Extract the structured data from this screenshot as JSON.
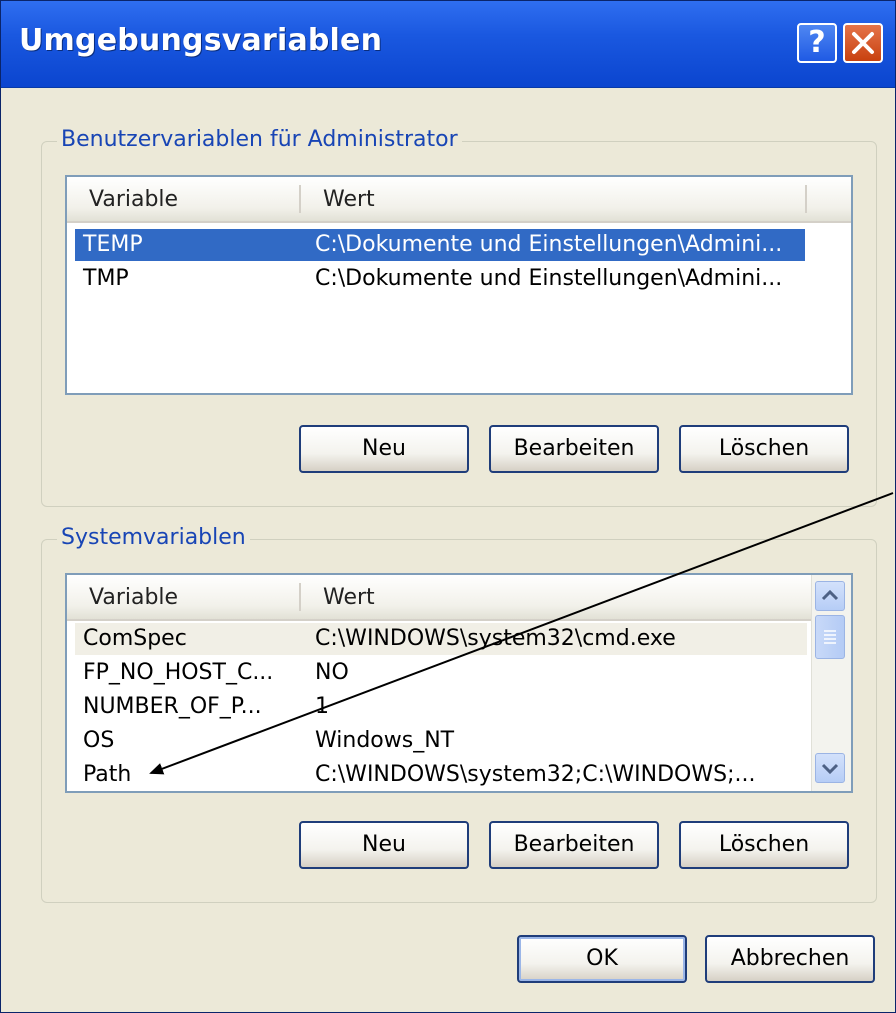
{
  "window": {
    "title": "Umgebungsvariablen",
    "help_glyph": "?",
    "colors": {
      "titlebar": "#1a58e0",
      "selection": "#316ac5",
      "group_label": "#1845b5"
    }
  },
  "user_vars": {
    "group_label": "Benutzervariablen für Administrator",
    "headers": {
      "variable": "Variable",
      "value": "Wert"
    },
    "rows": [
      {
        "name": "TEMP",
        "value": "C:\\Dokumente und Einstellungen\\Admini...",
        "selected": true
      },
      {
        "name": "TMP",
        "value": "C:\\Dokumente und Einstellungen\\Admini...",
        "selected": false
      }
    ],
    "buttons": {
      "new": "Neu",
      "edit": "Bearbeiten",
      "delete": "Löschen"
    }
  },
  "system_vars": {
    "group_label": "Systemvariablen",
    "headers": {
      "variable": "Variable",
      "value": "Wert"
    },
    "rows": [
      {
        "name": "ComSpec",
        "value": "C:\\WINDOWS\\system32\\cmd.exe"
      },
      {
        "name": "FP_NO_HOST_C...",
        "value": "NO"
      },
      {
        "name": "NUMBER_OF_P...",
        "value": "1"
      },
      {
        "name": "OS",
        "value": "Windows_NT"
      },
      {
        "name": "Path",
        "value": "C:\\WINDOWS\\system32;C:\\WINDOWS;..."
      }
    ],
    "buttons": {
      "new": "Neu",
      "edit": "Bearbeiten",
      "delete": "Löschen"
    }
  },
  "footer": {
    "ok": "OK",
    "cancel": "Abbrechen"
  },
  "icons": [
    "help-icon",
    "close-icon",
    "scroll-up-icon",
    "scroll-down-icon",
    "annotation-arrow-icon"
  ]
}
